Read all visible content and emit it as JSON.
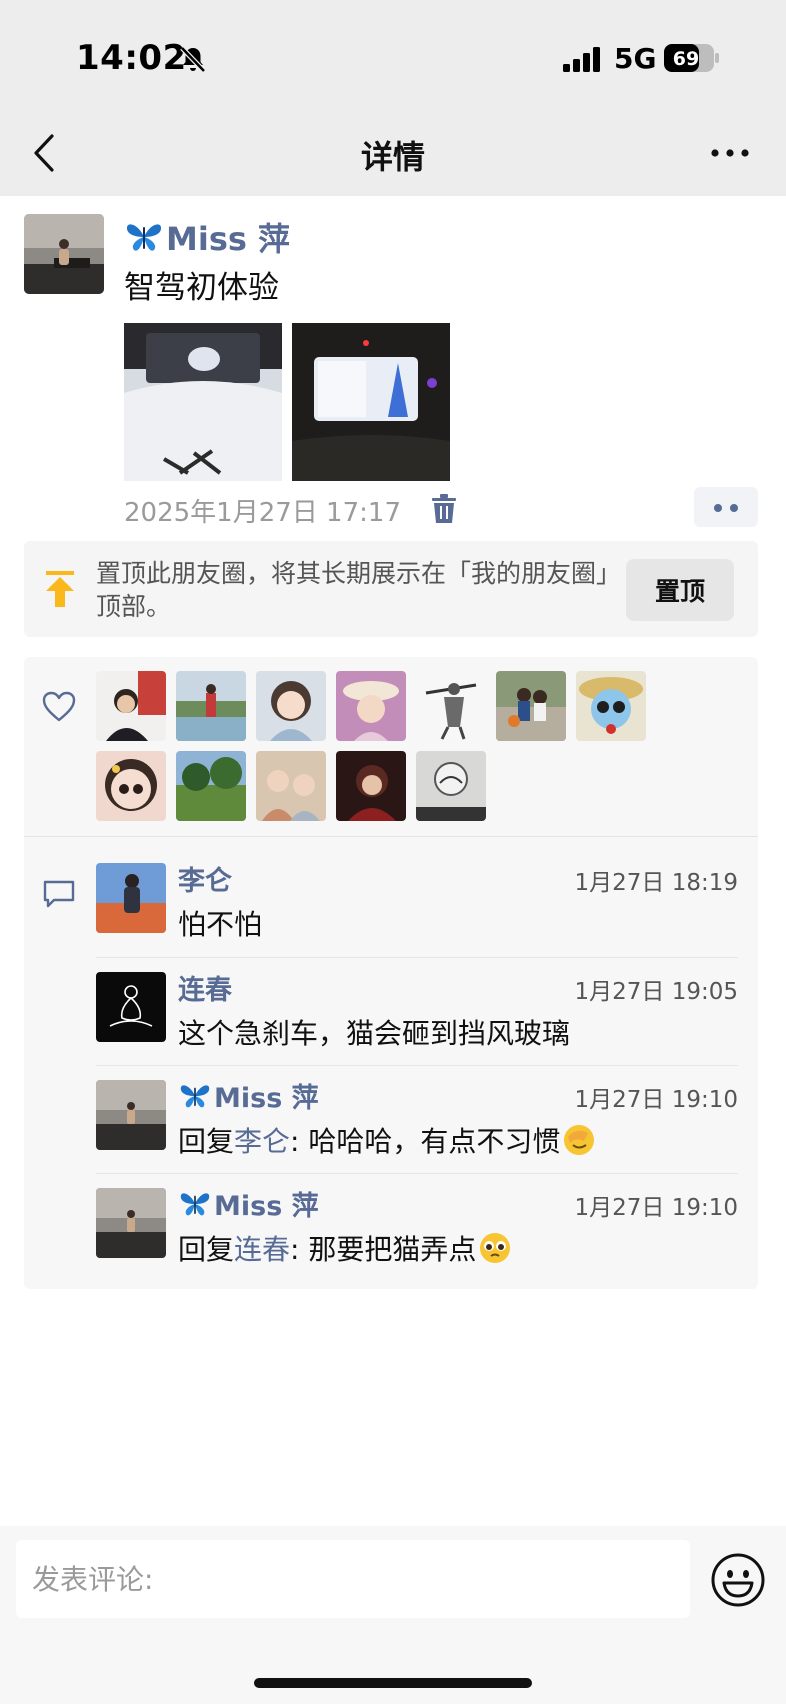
{
  "status_bar": {
    "time": "14:02",
    "network": "5G",
    "battery": "69"
  },
  "nav": {
    "title": "详情"
  },
  "post": {
    "author": "Miss 萍",
    "text": "智驾初体验",
    "timestamp": "2025年1月27日 17:17",
    "photos": [
      "car-steering-wheel-photo",
      "car-dashboard-screen-photo"
    ]
  },
  "pin_banner": {
    "text": "置顶此朋友圈，将其长期展示在「我的朋友圈」顶部。",
    "button": "置顶"
  },
  "likes": {
    "count_avatars": 12
  },
  "comments": [
    {
      "name": "李仑",
      "time": "1月27日 18:19",
      "text": "怕不怕"
    },
    {
      "name": "连春",
      "time": "1月27日 19:05",
      "text": "这个急刹车，猫会砸到挡风玻璃"
    },
    {
      "name": "Miss 萍",
      "time": "1月27日 19:10",
      "reply_prefix": "回复",
      "reply_to": "李仑",
      "text": ": 哈哈哈，有点不习惯"
    },
    {
      "name": "Miss 萍",
      "time": "1月27日 19:10",
      "reply_prefix": "回复",
      "reply_to": "连春",
      "text": ": 那要把猫弄点"
    }
  ],
  "composer": {
    "placeholder": "发表评论:"
  },
  "colors": {
    "link": "#576b95",
    "pin_icon": "#fbb81c"
  }
}
